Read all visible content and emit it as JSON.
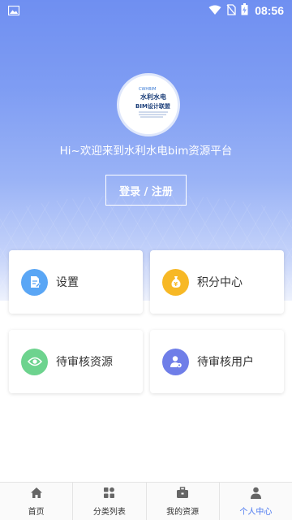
{
  "status_bar": {
    "time": "08:56"
  },
  "header": {
    "welcome": "Hi~欢迎来到水利水电bim资源平台",
    "login_label": "登录 / 注册",
    "logo": {
      "line1": "CWHBIM",
      "line2": "水利水电",
      "line3": "BIM设计联盟"
    }
  },
  "cards": [
    {
      "label": "设置",
      "icon": "document-icon",
      "color": "#5aa6f5"
    },
    {
      "label": "积分中心",
      "icon": "money-bag-icon",
      "color": "#f7b825"
    },
    {
      "label": "待审核资源",
      "icon": "eye-icon",
      "color": "#6dd38e"
    },
    {
      "label": "待审核用户",
      "icon": "user-gear-icon",
      "color": "#6f7ee8"
    }
  ],
  "tabbar": {
    "items": [
      {
        "label": "首页",
        "icon": "home-icon"
      },
      {
        "label": "分类列表",
        "icon": "grid-icon"
      },
      {
        "label": "我的资源",
        "icon": "briefcase-icon"
      },
      {
        "label": "个人中心",
        "icon": "person-icon"
      }
    ],
    "active_color": "#4a78f0"
  }
}
